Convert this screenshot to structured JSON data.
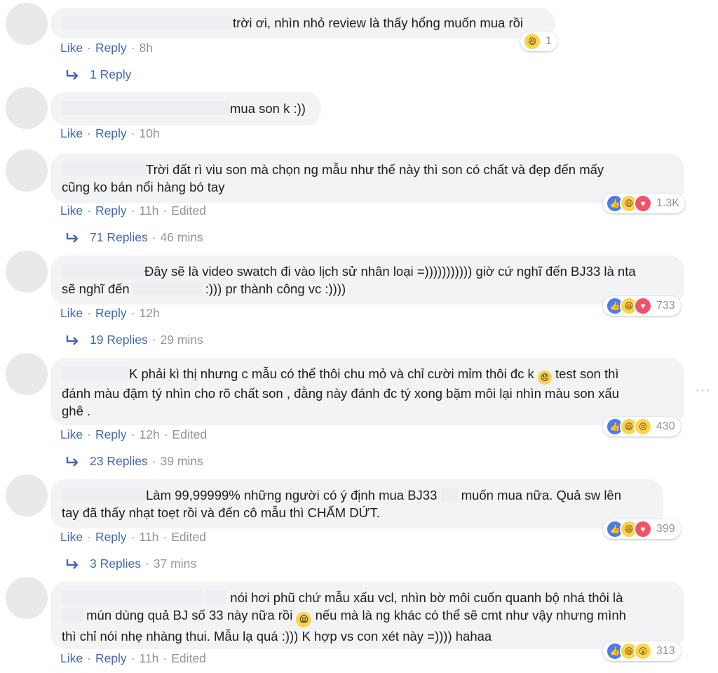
{
  "actions": {
    "like": "Like",
    "reply": "Reply",
    "edited": "Edited"
  },
  "comments": [
    {
      "text": "trời ơi, nhìn nhỏ review là thấy hổng muốn mua rồi",
      "time": "8h",
      "edited": false,
      "reactions": {
        "icons": [
          "haha"
        ],
        "count": "1"
      },
      "replies": {
        "label": "1 Reply",
        "time": ""
      }
    },
    {
      "text": "mua son k :))",
      "time": "10h",
      "edited": false
    },
    {
      "text1": "Trời đất rì viu son mà chọn ng mẫu như thế này thì son có chất và đẹp đến mấy",
      "text2": "cũng ko bán nổi hàng bó tay",
      "time": "11h",
      "edited": true,
      "reactions": {
        "icons": [
          "like",
          "haha",
          "love"
        ],
        "count": "1.3K"
      },
      "replies": {
        "label": "71 Replies",
        "time": "46 mins"
      }
    },
    {
      "text1": "Đây sẽ là video swatch đi vào lịch sử nhân loại =))))))))))) giờ cứ nghĩ đến BJ33 là nta",
      "text2a": "sẽ nghĩ đến",
      "text2b": ":))) pr thành công vc :))))",
      "time": "12h",
      "edited": false,
      "reactions": {
        "icons": [
          "like",
          "haha",
          "love"
        ],
        "count": "733"
      },
      "replies": {
        "label": "19 Replies",
        "time": "29 mins"
      }
    },
    {
      "text1": "K phải kì thị nhưng c mẫu có thể thôi chu mỏ và chỉ cười mỉm thôi đc k",
      "text1b": "test son thì",
      "text2": "đánh màu đậm tý nhìn cho rõ chất son , đằng này đánh đc tý xong bặm môi lại nhìn màu son xấu",
      "text3": "ghê .",
      "time": "12h",
      "edited": true,
      "reactions": {
        "icons": [
          "like",
          "haha",
          "sad"
        ],
        "count": "430"
      },
      "replies": {
        "label": "23 Replies",
        "time": "39 mins"
      }
    },
    {
      "text1a": "Làm 99,99999% những người có ý định mua BJ33",
      "text1b": "muốn mua nữa. Quả sw lên",
      "text2": "tay đã thấy nhạt toẹt rồi và đến cô mẫu thì CHẤM DỨT.",
      "time": "11h",
      "edited": true,
      "reactions": {
        "icons": [
          "like",
          "haha",
          "love"
        ],
        "count": "399"
      },
      "replies": {
        "label": "3 Replies",
        "time": "37 mins"
      }
    },
    {
      "text1": "nói hơi phũ chứ mẫu xấu vcl, nhìn bờ môi cuốn quanh bộ nhá thôi là",
      "text2a": "mún dùng quả BJ số 33 này nữa rồi",
      "text2b": "nếu mà là ng khác có thể sẽ cmt như vậy nhưng mình",
      "text3": "thì chỉ nói nhẹ nhàng thui. Mẫu lạ quá :))) K hợp vs con xét này =)))) hahaa",
      "time": "11h",
      "edited": true,
      "reactions": {
        "icons": [
          "like",
          "haha",
          "wow"
        ],
        "count": "313"
      }
    }
  ],
  "more_menu": "···"
}
